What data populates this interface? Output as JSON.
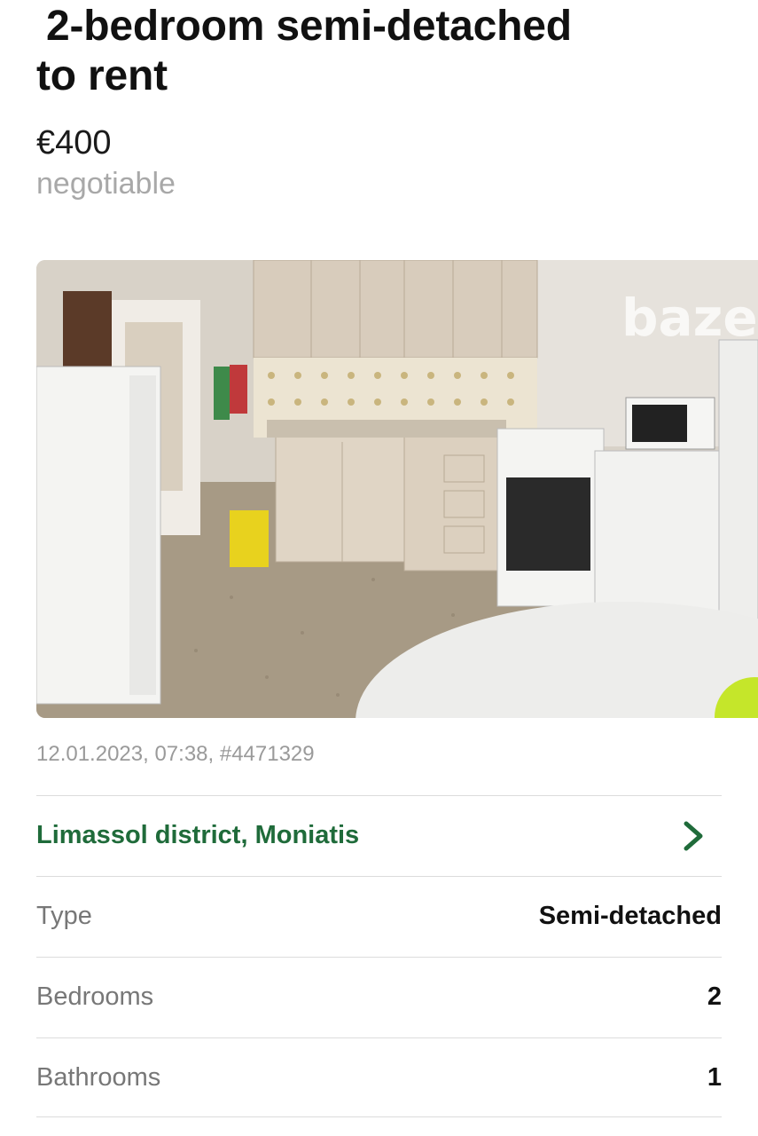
{
  "listing": {
    "title_line1": "2-bedroom semi-detached",
    "title_line2": "to rent",
    "price": "€400",
    "price_note": "negotiable",
    "photo_watermark": "baze",
    "meta": "12.01.2023, 07:38, #4471329",
    "location": "Limassol district, Moniatis",
    "location_icon": "chevron-right-icon",
    "accent_color": "#1f6b3a"
  },
  "details": [
    {
      "label": "Type",
      "value": "Semi-detached"
    },
    {
      "label": "Bedrooms",
      "value": "2"
    },
    {
      "label": "Bathrooms",
      "value": "1"
    }
  ]
}
